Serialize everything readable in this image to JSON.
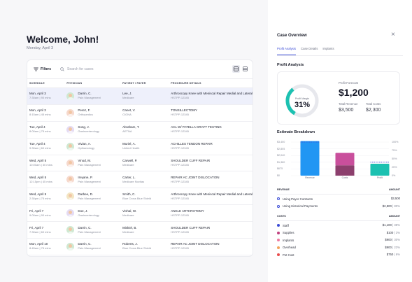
{
  "header": {
    "greeting": "Welcome, John!",
    "date": "Monday, April 3"
  },
  "toolbar": {
    "filters_label": "Filters",
    "search_placeholder": "Search for cases"
  },
  "table": {
    "columns": [
      "SCHEDULE",
      "PHYSICIAN",
      "PATIENT / PAYER",
      "PROCEDURE DETAILS"
    ],
    "rows": [
      {
        "date": "Mon, April 3",
        "time": "7:30am | 90 mins",
        "physician": "Darrin, C.",
        "specialty": "Pain Management",
        "patient": "Lee, J.",
        "payer": "Medicare",
        "procedure": "Arthroscopy Knee with Meniscal Repair Medial and Lateral",
        "code": "HSTPP-12345",
        "avatar_color": "#cfe9d2"
      },
      {
        "date": "Mon, April 3",
        "time": "8:15am | 45 mins",
        "physician": "Perez, F.",
        "specialty": "Orthopedics",
        "patient": "Canet, V.",
        "payer": "CIGNA",
        "procedure": "TONSILLECTOMY",
        "code": "HSTPP-12345",
        "avatar_color": "#f6d9cd"
      },
      {
        "date": "Tue, April 4",
        "time": "8:00am | 75 mins",
        "physician": "Song, J.",
        "specialty": "Gastroenterology",
        "patient": "Abraham, T.",
        "payer": "AETNA",
        "procedure": "ACL W/ PATELLA GRAFT TESTING",
        "code": "HSTPP-12345",
        "avatar_color": "#e4dbf3"
      },
      {
        "date": "Tue, April 4",
        "time": "9:30am | 60 mins",
        "physician": "Vivian, A.",
        "specialty": "Opthamology",
        "patient": "Muriel, A.",
        "payer": "United Health",
        "procedure": "ACHILLES TENDON REPAIR",
        "code": "HSTPP-12345",
        "avatar_color": "#cfe9d2"
      },
      {
        "date": "Wed, April 5",
        "time": "10:00am | 30 mins",
        "physician": "Vinod, M.",
        "specialty": "Pain Management",
        "patient": "Carwell, P.",
        "payer": "Medicare",
        "procedure": "SHOULDER CUFF REPAIR",
        "code": "HSTPP-12345",
        "avatar_color": "#f6d9cd"
      },
      {
        "date": "Wed, April 5",
        "time": "12:15pm | 45 mins",
        "physician": "Ireyane, P.",
        "specialty": "Pain Management",
        "patient": "Carter, L.",
        "payer": "Medicare Novitas",
        "procedure": "REPAIR AC JOINT DISLOCATION",
        "code": "HSTPP-12345",
        "avatar_color": "#f6d9cd"
      },
      {
        "date": "Wed, April 5",
        "time": "2:30pm | 75 mins",
        "physician": "Darbee, D.",
        "specialty": "Pain Management",
        "patient": "Smith, C.",
        "payer": "Blue Cross Blue Shield",
        "procedure": "Arthroscopy Knee with Meniscal Repair Medial and Lateral",
        "code": "HSTPP-12345",
        "avatar_color": "#f3e6c4"
      },
      {
        "date": "Fri, April 7",
        "time": "9:00am | 90 mins",
        "physician": "Doe, J.",
        "specialty": "Gastroenterology",
        "patient": "Vishal, W.",
        "payer": "Medicare",
        "procedure": "ANKLE ARTHROTOMY",
        "code": "HSTPP-12345",
        "avatar_color": "#e4dbf3"
      },
      {
        "date": "Fri, April 7",
        "time": "7:30am | 60 mins",
        "physician": "Darrin, C.",
        "specialty": "Pain Management",
        "patient": "Miskiel, B.",
        "payer": "Medicare",
        "procedure": "SHOULDER CUFF REPAIR",
        "code": "HSTPP-12345",
        "avatar_color": "#cfe9d2"
      },
      {
        "date": "Mon, April 10",
        "time": "8:45am | 75 mins",
        "physician": "Darrin, C.",
        "specialty": "Pain Management",
        "patient": "Roberts, J.",
        "payer": "Blue Cross Blue Shield",
        "procedure": "REPAIR AC JOINT DISLOCATION",
        "code": "HSTPP-12345",
        "avatar_color": "#cfe9d2"
      }
    ]
  },
  "panel": {
    "title": "Case Overview",
    "tabs": [
      {
        "label": "Profit Analysis",
        "active": true
      },
      {
        "label": "Case Details",
        "active": false
      },
      {
        "label": "Implants",
        "active": false
      }
    ],
    "profit_analysis": {
      "heading": "Profit Analysis",
      "margin_label": "Profit Margin",
      "margin_value": "31%",
      "margin_fraction": 0.31,
      "forecast_label": "Profit Forecast",
      "forecast_value": "$1,200",
      "total_revenue_label": "Total Revenue",
      "total_revenue_value": "$3,500",
      "total_costs_label": "Total Costs",
      "total_costs_value": "$2,300"
    },
    "estimate_breakdown": {
      "heading": "Estimate Breakdown",
      "colors": {
        "revenue": "#2196f3",
        "costs_top": "#c94f9c",
        "costs_bottom": "#8c3f6d",
        "profit": "#1cc1b1",
        "target": "#3a4bd6"
      }
    },
    "revenue": {
      "header": "REVENUE",
      "amount_header": "AMOUNT",
      "items": [
        {
          "label": "Using Payer Contracts",
          "amount": "$3,500",
          "sub": ""
        },
        {
          "label": "Using Historical Payments",
          "amount": "$2,800",
          "sub": "| 80%"
        }
      ]
    },
    "costs": {
      "header": "COSTS",
      "amount_header": "AMOUNT",
      "items": [
        {
          "label": "Staff",
          "amount": "$1,100",
          "sub": "| 38%",
          "color": "#3a4bd6"
        },
        {
          "label": "Supplies",
          "amount": "$100",
          "sub": "| 3%",
          "color": "#c0407f"
        },
        {
          "label": "Implants",
          "amount": "$900",
          "sub": "| 30%",
          "color": "#ef7aa0"
        },
        {
          "label": "Overhead",
          "amount": "$900",
          "sub": "| 23%",
          "color": "#f3a45c"
        },
        {
          "label": "Pot Cost",
          "amount": "$750",
          "sub": "| 6%",
          "color": "#e84d4d"
        }
      ]
    }
  },
  "chart_data": {
    "type": "bar",
    "categories": [
      "Revenue",
      "Costs",
      "Profit"
    ],
    "series": [
      {
        "name": "Revenue",
        "values": [
          3500,
          0,
          0
        ]
      },
      {
        "name": "Costs",
        "values": [
          0,
          2300,
          0
        ]
      },
      {
        "name": "Profit",
        "values": [
          0,
          0,
          1200
        ]
      }
    ],
    "left_ticks": [
      "$3,400",
      "$2,805",
      "$2,040",
      "$1,360",
      "$675",
      "$0"
    ],
    "right_ticks": [
      "100%",
      "75%",
      "50%",
      "25%",
      "0%"
    ],
    "ylim": [
      0,
      3400
    ],
    "target_lines": [
      3400,
      3400,
      1360
    ]
  }
}
